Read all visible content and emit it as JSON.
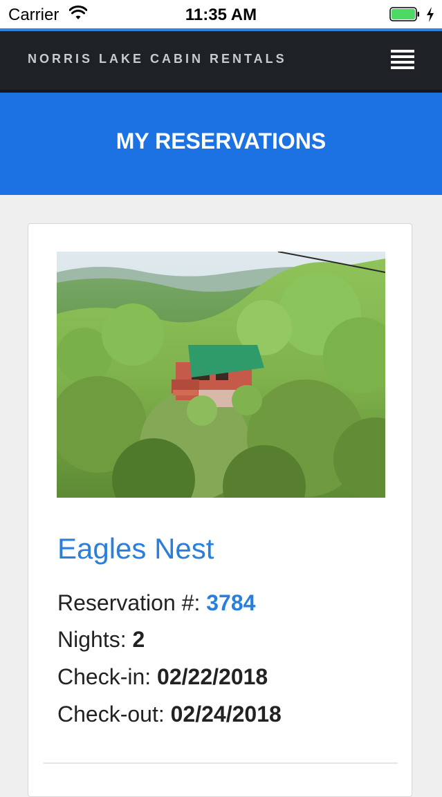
{
  "status_bar": {
    "carrier": "Carrier",
    "time": "11:35 AM",
    "battery_color": "#4cd964"
  },
  "navbar": {
    "brand": "NORRIS LAKE CABIN RENTALS",
    "menu_icon": "hamburger-menu-icon"
  },
  "banner": {
    "title": "MY RESERVATIONS",
    "color": "#1c72e3"
  },
  "reservation": {
    "cabin_name": "Eagles Nest",
    "reservation_label": "Reservation #: ",
    "reservation_number": "3784",
    "nights_label": "Nights: ",
    "nights": "2",
    "checkin_label": "Check-in: ",
    "checkin": "02/22/2018",
    "checkout_label": "Check-out: ",
    "checkout": "02/24/2018"
  },
  "colors": {
    "accent": "#2a7fdc",
    "navbar": "#1e2226"
  }
}
